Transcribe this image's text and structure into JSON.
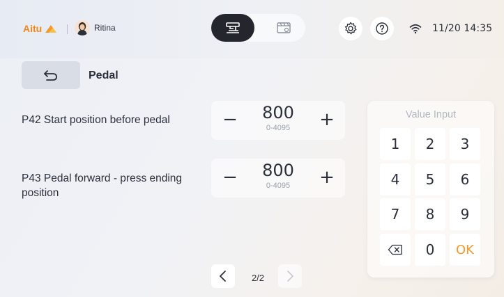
{
  "header": {
    "brand": "Aitu",
    "user_name": "Ritina",
    "datetime": "11/20 14:35",
    "modes": [
      {
        "icon": "sewing-machine-icon",
        "active": true
      },
      {
        "icon": "video-tutorial-icon",
        "active": false
      }
    ],
    "settings_icon": "gear-icon",
    "help_icon": "help-circle-icon",
    "wifi_icon": "wifi-icon"
  },
  "page": {
    "title": "Pedal",
    "back_icon": "undo-arrow-icon"
  },
  "params": [
    {
      "label": "P42 Start position before pedal",
      "value": "800",
      "range": "0-4095",
      "minus": "−",
      "plus": "+"
    },
    {
      "label_line1": "P43 Pedal forward - press ending",
      "label_line2": "position",
      "value": "800",
      "range": "0-4095",
      "minus": "−",
      "plus": "+"
    }
  ],
  "keypad": {
    "title": "Value Input",
    "keys": [
      "1",
      "2",
      "3",
      "4",
      "5",
      "6",
      "7",
      "8",
      "9",
      "⌫",
      "0",
      "OK"
    ]
  },
  "pager": {
    "text": "2/2",
    "prev_icon": "chevron-left-icon",
    "next_icon": "chevron-right-icon"
  },
  "colors": {
    "accent": "#f29a2c",
    "brand": "#f08a1c",
    "dark": "#23262d"
  }
}
